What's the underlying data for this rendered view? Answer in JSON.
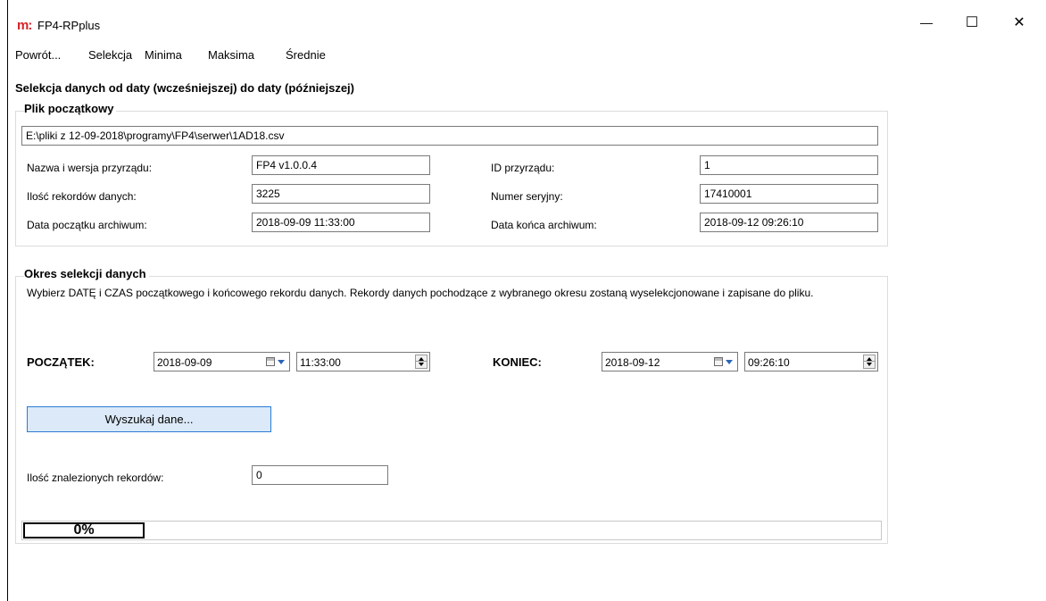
{
  "window": {
    "app_logo": "m:",
    "title": "FP4-RPplus",
    "minimize": "—",
    "maximize": "☐",
    "close": "✕"
  },
  "menu": {
    "items": [
      "Powrót...",
      "Selekcja",
      "Minima",
      "Maksima",
      "Średnie"
    ]
  },
  "heading": "Selekcja danych od daty (wcześniejszej) do daty (późniejszej)",
  "source_file": {
    "group_title": "Plik początkowy",
    "path": "E:\\pliki z 12-09-2018\\programy\\FP4\\serwer\\1AD18.csv",
    "device_name_label": "Nazwa i wersja przyrządu:",
    "device_name_value": "FP4 v1.0.0.4",
    "device_id_label": "ID przyrządu:",
    "device_id_value": "1",
    "record_count_label": "Ilość rekordów danych:",
    "record_count_value": "3225",
    "serial_label": "Numer seryjny:",
    "serial_value": "17410001",
    "archive_start_label": "Data początku archiwum:",
    "archive_start_value": "2018-09-09 11:33:00",
    "archive_end_label": "Data końca archiwum:",
    "archive_end_value": "2018-09-12 09:26:10"
  },
  "selection": {
    "group_title": "Okres selekcji danych",
    "description": "Wybierz DATĘ i CZAS początkowego i końcowego rekordu danych. Rekordy danych pochodzące z wybranego okresu zostaną wyselekcjonowane i zapisane do pliku.",
    "start_label": "POCZĄTEK:",
    "start_date": "2018-09-09",
    "start_time": "11:33:00",
    "end_label": "KONIEC:",
    "end_date": "2018-09-12",
    "end_time": "09:26:10",
    "search_button": "Wyszukaj dane...",
    "found_label": "Ilość znalezionych rekordów:",
    "found_value": "0",
    "progress_text": "0%",
    "progress_fraction": 0
  },
  "colors": {
    "logo_red": "#d8232a",
    "button_border": "#2b7cd3",
    "button_fill": "#dbe9f8",
    "progress_green": "#06b025"
  },
  "icons": {
    "calendar": "calendar-icon",
    "dropdown": "chevron-down-icon",
    "spinner": "spin-updown-icon"
  }
}
